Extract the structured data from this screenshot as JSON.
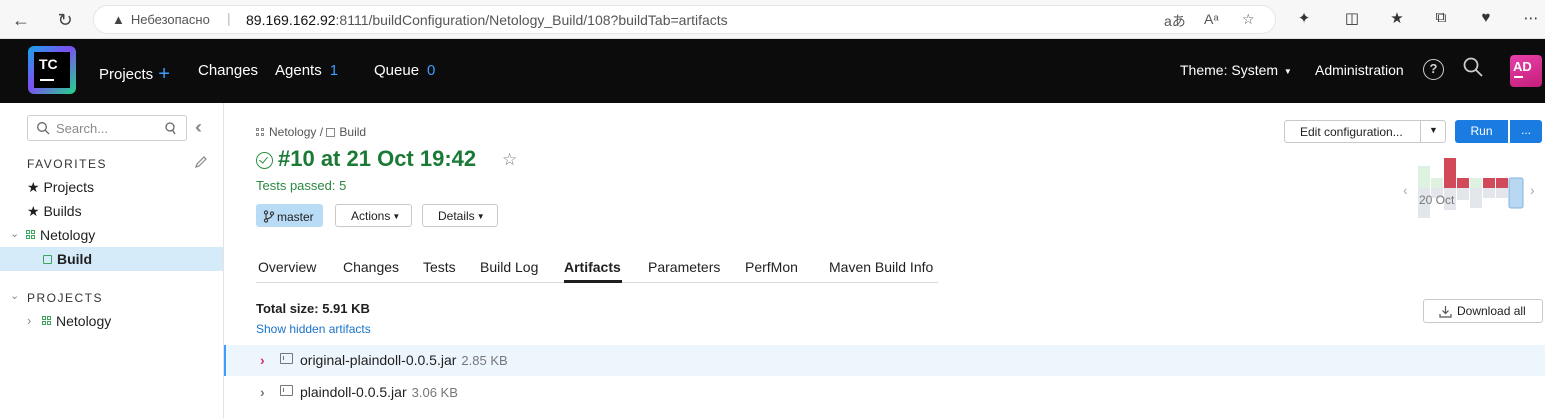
{
  "browser": {
    "insecure_label": "Небезопасно",
    "url_host": "89.169.162.92",
    "url_rest": ":8111/buildConfiguration/Netology_Build/108?buildTab=artifacts"
  },
  "header": {
    "projects": "Projects",
    "changes": "Changes",
    "agents": "Agents",
    "agents_count": "1",
    "queue": "Queue",
    "queue_count": "0",
    "theme": "Theme: System",
    "administration": "Administration",
    "avatar_initials": "AD",
    "logo_text": "TC"
  },
  "sidebar": {
    "search_placeholder": "Search...",
    "favorites_title": "FAVORITES",
    "favorites": [
      {
        "label": "Projects"
      },
      {
        "label": "Builds"
      },
      {
        "label": "Netology"
      },
      {
        "label": "Build"
      }
    ],
    "projects_title": "PROJECTS",
    "projects": [
      {
        "label": "Netology"
      }
    ]
  },
  "breadcrumb": {
    "project": "Netology",
    "sep": "/",
    "build": "Build"
  },
  "build": {
    "title": "#10 at 21 Oct 19:42",
    "tests_status": "Tests passed: 5",
    "branch": "master",
    "actions_label": "Actions",
    "details_label": "Details"
  },
  "tabs": [
    {
      "label": "Overview"
    },
    {
      "label": "Changes"
    },
    {
      "label": "Tests"
    },
    {
      "label": "Build Log"
    },
    {
      "label": "Artifacts",
      "active": true
    },
    {
      "label": "Parameters"
    },
    {
      "label": "PerfMon"
    },
    {
      "label": "Maven Build Info"
    }
  ],
  "artifacts": {
    "total_size": "Total size: 5.91 KB",
    "show_hidden": "Show hidden artifacts",
    "download_all": "Download all",
    "items": [
      {
        "name": "original-plaindoll-0.0.5.jar",
        "size": "2.85 KB",
        "highlighted": true
      },
      {
        "name": "plaindoll-0.0.5.jar",
        "size": "3.06 KB",
        "highlighted": false
      }
    ]
  },
  "actions": {
    "edit_configuration": "Edit configuration...",
    "run": "Run",
    "more": "..."
  },
  "history_chart": {
    "date_label": "20 Oct",
    "colors": {
      "success": "#dff2e1",
      "failure": "#d24a5a",
      "neutral": "#e3e6ea",
      "selected": "#b8d7f0"
    }
  },
  "colors": {
    "accent": "#1a7ce0",
    "success_text": "#1b7a35",
    "selected_row": "#d6ebfa"
  }
}
